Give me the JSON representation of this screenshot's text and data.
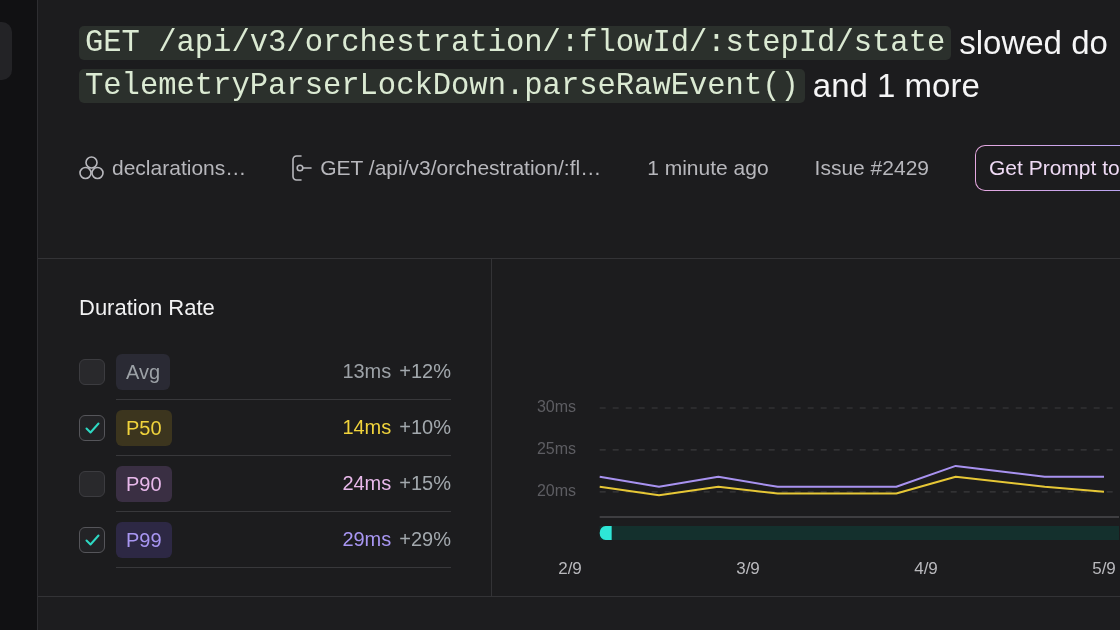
{
  "title": {
    "lines": [
      {
        "segments": [
          {
            "kind": "code",
            "text": "GET /api/v3/orchestration/:flowId/:stepId/state"
          },
          {
            "kind": "text",
            "text": "slowed do"
          }
        ]
      },
      {
        "segments": [
          {
            "kind": "code",
            "text": "TelemetryParserLockDown.parseRawEvent()"
          },
          {
            "kind": "text",
            "text": "and 1 more"
          }
        ]
      }
    ]
  },
  "meta": {
    "items": [
      {
        "kind": "circles",
        "text": "declarations…"
      },
      {
        "kind": "bracket",
        "text": "GET /api/v3/orchestration/:fl…"
      },
      {
        "kind": "text",
        "text": "1 minute ago"
      },
      {
        "kind": "text",
        "text": "Issue #2429"
      }
    ],
    "button": "Get Prompt to"
  },
  "duration_rate": {
    "title": "Duration Rate",
    "metrics": [
      {
        "label": "Avg",
        "checked": false,
        "color": "#9ca1a6",
        "value": "13ms",
        "change": "+12%"
      },
      {
        "label": "P50",
        "checked": true,
        "color": "#f0d33c",
        "value": "14ms",
        "change": "+10%"
      },
      {
        "label": "P90",
        "checked": false,
        "color": "#e8b8ea",
        "value": "24ms",
        "change": "+15%"
      },
      {
        "label": "P99",
        "checked": true,
        "color": "#a896f2",
        "value": "29ms",
        "change": "+29%"
      }
    ]
  },
  "chart": {
    "chart_data": {
      "type": "line",
      "grid": true,
      "categories": [
        "2/9",
        null,
        null,
        null,
        null,
        null,
        "3/9",
        null,
        null,
        null,
        null,
        null,
        "4/9",
        null,
        null,
        null,
        null,
        null,
        "5/9"
      ],
      "series": [
        {
          "color": "#e6c736",
          "values": [
            null,
            20.6,
            null,
            19.6,
            null,
            20.6,
            null,
            19.8,
            null,
            null,
            null,
            19.8,
            null,
            21.8,
            null,
            null,
            20.6,
            null,
            20.0
          ]
        },
        {
          "color": "#a892f0",
          "values": [
            null,
            21.8,
            null,
            20.6,
            null,
            21.8,
            null,
            20.6,
            null,
            null,
            null,
            20.6,
            null,
            23.1,
            null,
            null,
            21.8,
            null,
            21.8
          ]
        }
      ],
      "ylim": [
        17,
        30
      ],
      "yticks": [
        {
          "value": 20,
          "label": "20ms"
        },
        {
          "value": 25,
          "label": "25ms"
        },
        {
          "value": 30,
          "label": "30ms"
        }
      ]
    }
  }
}
